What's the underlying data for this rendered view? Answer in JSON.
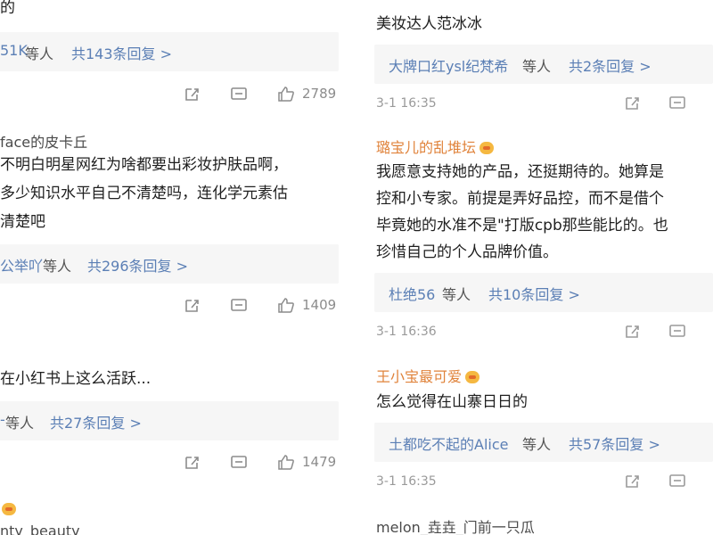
{
  "left": {
    "c0_text": "的",
    "c0_reply_names": "51K",
    "c0_reply_etc": "等人",
    "c0_reply_count": "共143条回复 >",
    "c0_likes": "2789",
    "c1_user": "face的皮卡丘",
    "c1_line1": "不明白明星网红为啥都要出彩妆护肤品啊，",
    "c1_line2": "多少知识水平自己不清楚吗，连化学元素估",
    "c1_line3": "清楚吧",
    "c1_reply_names": "公举吖",
    "c1_reply_etc": "等人",
    "c1_reply_count": "共296条回复 >",
    "c1_likes": "1409",
    "c2_text": "在小红书上这么活跃...",
    "c2_reply_names": "-",
    "c2_reply_etc": "等人",
    "c2_reply_count": "共27条回复 >",
    "c2_likes": "1479",
    "c3_user": "nty_beauty"
  },
  "right": {
    "c0_text": "美妆达人范冰冰",
    "c0_reply_names": "大牌口红ysl纪梵希",
    "c0_reply_etc": "等人",
    "c0_reply_count": "共2条回复 >",
    "c0_time": "3-1 16:35",
    "c1_user": "璐宝儿的乱堆坛",
    "c1_line1": "我愿意支持她的产品，还挺期待的。她算是",
    "c1_line2": "控和小专家。前提是弄好品控，而不是借个",
    "c1_line3": "毕竟她的水准不是\"打版cpb那些能比的。也",
    "c1_line4": "珍惜自己的个人品牌价值。",
    "c1_reply_names": "杜绝56",
    "c1_reply_etc": "等人",
    "c1_reply_count": "共10条回复 >",
    "c1_time": "3-1 16:36",
    "c2_user": "王小宝最可爱",
    "c2_text": "怎么觉得在山寨日日的",
    "c2_reply_names": "土都吃不起的Alice",
    "c2_reply_etc": "等人",
    "c2_reply_count": "共57条回复 >",
    "c2_time": "3-1 16:35",
    "c3_user": "melon_垚垚_门前一只瓜"
  },
  "icons": [
    "share-icon",
    "comment-icon",
    "like-icon"
  ],
  "colors": {
    "link": "#5b7fb5",
    "orange_name": "#e0833b",
    "reply_bg": "#f6f6f6",
    "meta_gray": "#9a9a9a"
  }
}
